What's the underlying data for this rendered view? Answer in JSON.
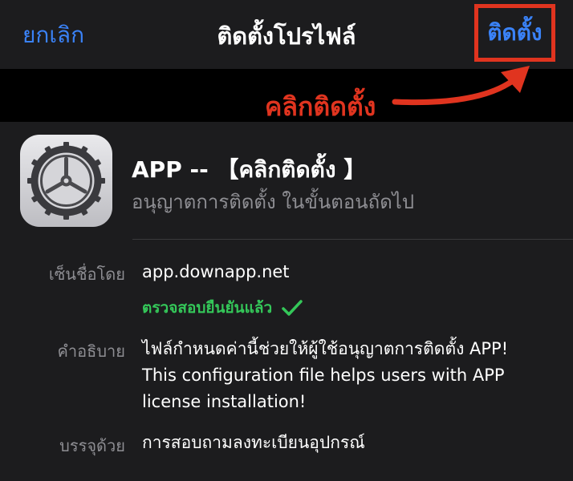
{
  "nav": {
    "cancel": "ยกเลิก",
    "title": "ติดตั้งโปรไฟล์",
    "install": "ติดตั้ง"
  },
  "annotation": {
    "text": "คลิกติดตั้ง"
  },
  "profile": {
    "name": "APP -- 【คลิกติดตั้ง 】",
    "subtitle": "อนุญาตการติดตั้ง ในขั้นตอนถัดไป"
  },
  "details": {
    "signed_label": "เซ็นชื่อโดย",
    "signed_value": "app.downapp.net",
    "verified": "ตรวจสอบยืนยันแล้ว",
    "description_label": "คำอธิบาย",
    "description_lines": [
      "ไฟล์กำหนดค่านี้ช่วยให้ผู้ใช้อนุญาตการติดตั้ง APP!",
      "This configuration file helps users with APP",
      "license installation!"
    ],
    "contains_label": "บรรจุด้วย",
    "contains_value": "การสอบถามลงทะเบียนอุปกรณ์"
  },
  "colors": {
    "accent_blue": "#3a82f7",
    "annotation_red": "#e0341f",
    "verified_green": "#34c759"
  },
  "icons": {
    "app_icon": "settings-gear-icon",
    "verified_icon": "checkmark-icon",
    "annotation_arrow": "curved-arrow-icon"
  }
}
